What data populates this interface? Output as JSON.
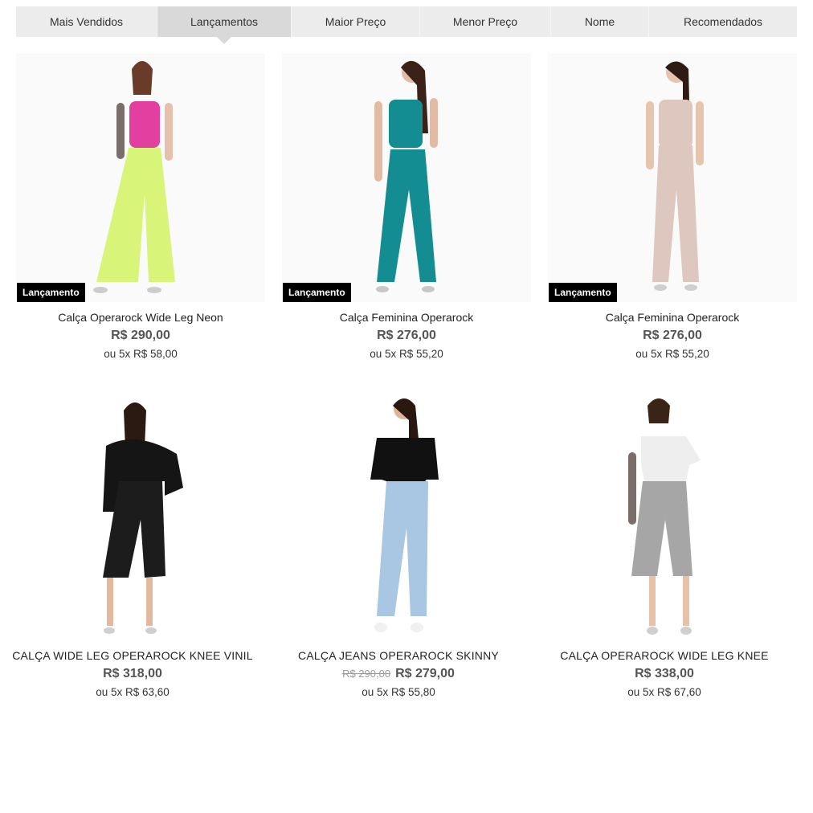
{
  "sort": {
    "tabs": [
      {
        "label": "Mais Vendidos"
      },
      {
        "label": "Lançamentos"
      },
      {
        "label": "Maior Preço"
      },
      {
        "label": "Menor Preço"
      },
      {
        "label": "Nome"
      },
      {
        "label": "Recomendados"
      }
    ],
    "active": "Lançamentos"
  },
  "products": [
    {
      "name": "Calça Operarock Wide Leg Neon",
      "price": "R$ 290,00",
      "installments": "ou 5x R$ 58,00",
      "badge": "Lançamento",
      "top_color": "#e23fa0",
      "bottom_color": "#d8f57a"
    },
    {
      "name": "Calça Feminina Operarock",
      "price": "R$ 276,00",
      "installments": "ou 5x R$ 55,20",
      "badge": "Lançamento",
      "top_color": "#138d92",
      "bottom_color": "#138d92"
    },
    {
      "name": "Calça Feminina Operarock",
      "price": "R$ 276,00",
      "installments": "ou 5x R$ 55,20",
      "badge": "Lançamento",
      "top_color": "#ddc7bf",
      "bottom_color": "#ddc7bf"
    },
    {
      "name": "CALÇA WIDE LEG OPERAROCK KNEE VINIL",
      "price": "R$ 318,00",
      "installments": "ou 5x R$ 63,60",
      "top_color": "#151515",
      "bottom_color": "#1c1c1c"
    },
    {
      "name": "CALÇA JEANS OPERAROCK SKINNY",
      "old_price": "R$ 290,00",
      "price": "R$ 279,00",
      "installments": "ou 5x R$ 55,80",
      "top_color": "#111111",
      "bottom_color": "#a9c6e2"
    },
    {
      "name": "CALÇA OPERAROCK WIDE LEG KNEE",
      "price": "R$ 338,00",
      "installments": "ou 5x R$ 67,60",
      "top_color": "#eeeeee",
      "bottom_color": "#a6a6a6"
    }
  ]
}
